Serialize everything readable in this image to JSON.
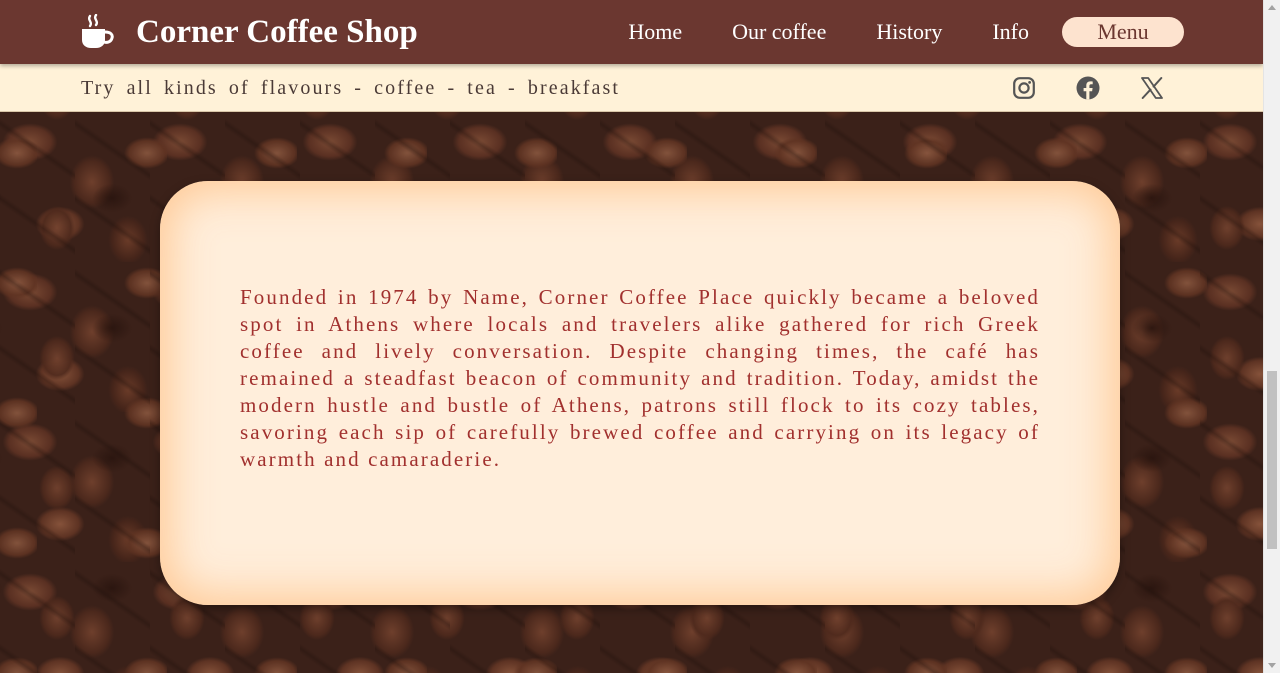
{
  "header": {
    "brand": "Corner Coffee Shop",
    "logo_icon": "coffee-cup-icon",
    "nav": [
      {
        "label": "Home"
      },
      {
        "label": "Our coffee"
      },
      {
        "label": "History"
      },
      {
        "label": "Info"
      }
    ],
    "menu_button": "Menu"
  },
  "subbar": {
    "tagline": "Try all kinds of flavours - coffee - tea - breakfast",
    "socials": [
      "instagram-icon",
      "facebook-icon",
      "x-icon"
    ]
  },
  "hero": {
    "background": "coffee-beans-image"
  },
  "card": {
    "text": "Founded in 1974 by Name, Corner Coffee Place quickly became a beloved spot in Athens where locals and travelers alike gathered for rich Greek coffee and lively conversation. Despite changing times, the café has remained a steadfast beacon of community and tradition. Today, amidst the modern hustle and bustle of Athens, patrons still flock to its cozy tables, savoring each sip of carefully brewed coffee and carrying on its legacy of warmth and camaraderie."
  },
  "colors": {
    "header_bg": "#6b3730",
    "subbar_bg": "#fff2d8",
    "card_bg": "#ffeedb",
    "card_text": "#a1302e",
    "menu_button_bg": "#fde3cf"
  }
}
